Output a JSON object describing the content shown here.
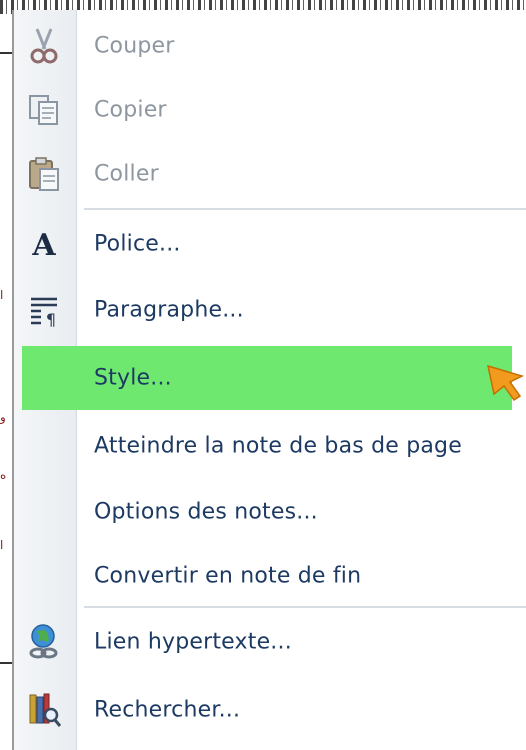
{
  "menu": {
    "items": [
      {
        "label": "Couper",
        "icon": "scissors-icon",
        "disabled": true
      },
      {
        "label": "Copier",
        "icon": "copy-icon",
        "disabled": true
      },
      {
        "label": "Coller",
        "icon": "paste-icon",
        "disabled": true
      },
      {
        "label": "Police...",
        "icon": "font-icon",
        "disabled": false
      },
      {
        "label": "Paragraphe...",
        "icon": "paragraph-icon",
        "disabled": false
      },
      {
        "label": "Style...",
        "icon": "",
        "disabled": false,
        "highlighted": true
      },
      {
        "label": "Atteindre la note de bas de page",
        "icon": "",
        "disabled": false
      },
      {
        "label": "Options des notes...",
        "icon": "",
        "disabled": false
      },
      {
        "label": "Convertir en note de fin",
        "icon": "",
        "disabled": false
      },
      {
        "label": "Lien hypertexte...",
        "icon": "hyperlink-globe-icon",
        "disabled": false
      },
      {
        "label": "Rechercher...",
        "icon": "research-icon",
        "disabled": false
      }
    ]
  },
  "colors": {
    "highlight": "#6ee86e",
    "text": "#1d3a63",
    "disabled_text": "#8e96a0",
    "cursor": "#f29a1e"
  }
}
